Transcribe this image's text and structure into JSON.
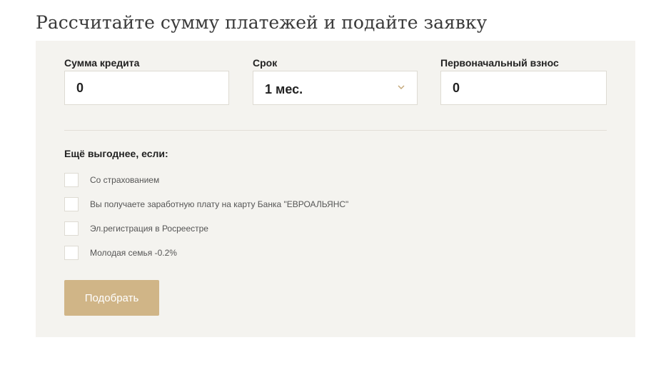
{
  "page": {
    "title": "Рассчитайте сумму платежей и подайте заявку"
  },
  "form": {
    "loan_amount": {
      "label": "Сумма кредита",
      "value": "0"
    },
    "term": {
      "label": "Срок",
      "selected": "1 мес.",
      "icon": "chevron-down-icon"
    },
    "down_payment": {
      "label": "Первоначальный взнос",
      "value": "0"
    },
    "options_title": "Ещё выгоднее, если:",
    "options": [
      {
        "label": "Со страхованием",
        "checked": false
      },
      {
        "label": "Вы получаете заработную плату на карту Банка \"ЕВРОАЛЬЯНС\"",
        "checked": false
      },
      {
        "label": "Эл.регистрация в Росреестре",
        "checked": false
      },
      {
        "label": "Молодая семья -0.2%",
        "checked": false
      }
    ],
    "submit_label": "Подобрать"
  },
  "colors": {
    "panel_bg": "#f4f3ef",
    "accent": "#d0b587",
    "field_border": "#dedbd3",
    "chevron": "#c4a676"
  }
}
